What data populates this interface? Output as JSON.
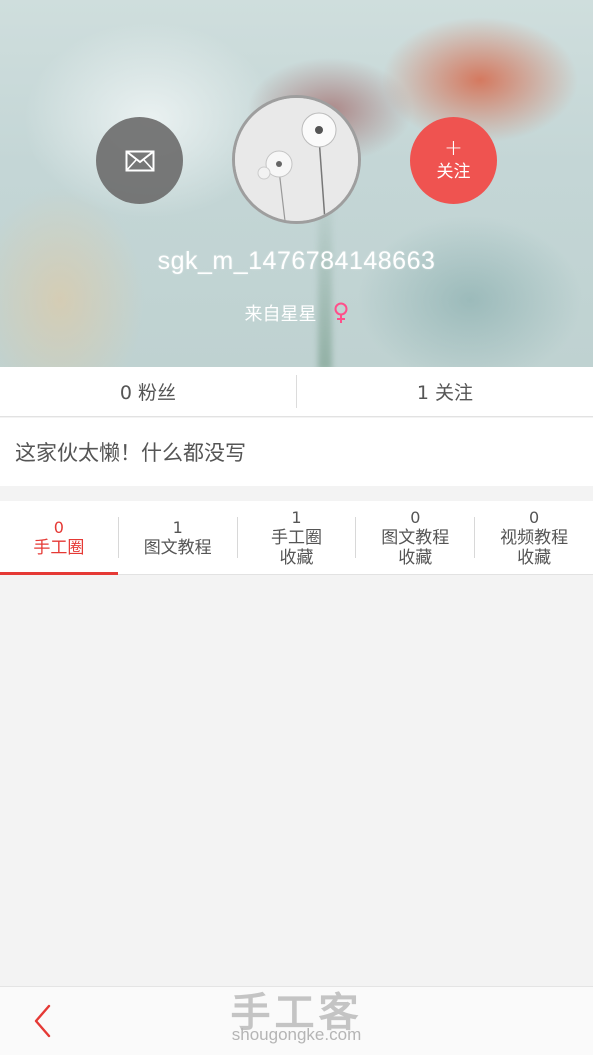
{
  "profile": {
    "username": "sgk_m_1476784148663",
    "location": "来自星星",
    "gender_icon": "female-icon",
    "follow_plus": "+",
    "follow_label": "关注"
  },
  "stats": {
    "fans": "0 粉丝",
    "following": "1 关注"
  },
  "bio": "这家伙太懒！什么都没写",
  "tabs": [
    {
      "count": "0",
      "line1": "手工圈",
      "line2": "",
      "active": true
    },
    {
      "count": "1",
      "line1": "图文教程",
      "line2": "",
      "active": false
    },
    {
      "count": "1",
      "line1": "手工圈",
      "line2": "收藏",
      "active": false
    },
    {
      "count": "0",
      "line1": "图文教程",
      "line2": "收藏",
      "active": false
    },
    {
      "count": "0",
      "line1": "视频教程",
      "line2": "收藏",
      "active": false
    }
  ],
  "watermark": {
    "cn": "手工客",
    "en": "shougongke.com"
  },
  "colors": {
    "accent": "#e53935",
    "follow_button": "#ef5350",
    "message_button": "#6e6e6e",
    "gender": "#ff4f8a"
  }
}
